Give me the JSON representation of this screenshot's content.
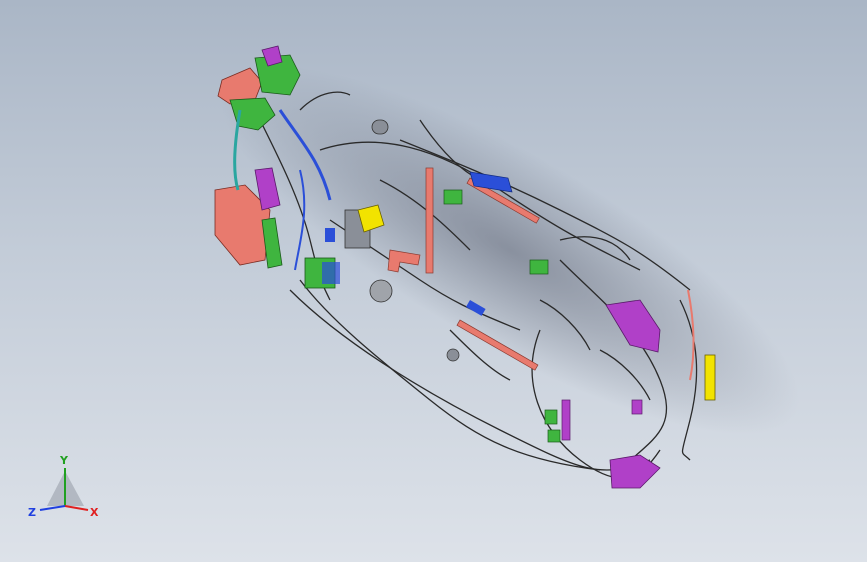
{
  "colors": {
    "wire": "#2a2a2a",
    "salmon": "#e87a6e",
    "green": "#3fb53f",
    "magenta": "#b040c8",
    "yellow": "#f2e300",
    "blue": "#2b4fd8",
    "teal": "#2aa6a0",
    "gray": "#8a8f98"
  },
  "triad": {
    "x_label": "X",
    "y_label": "Y",
    "z_label": "Z",
    "x_color": "#e02020",
    "y_color": "#20a020",
    "z_color": "#2040e0"
  }
}
